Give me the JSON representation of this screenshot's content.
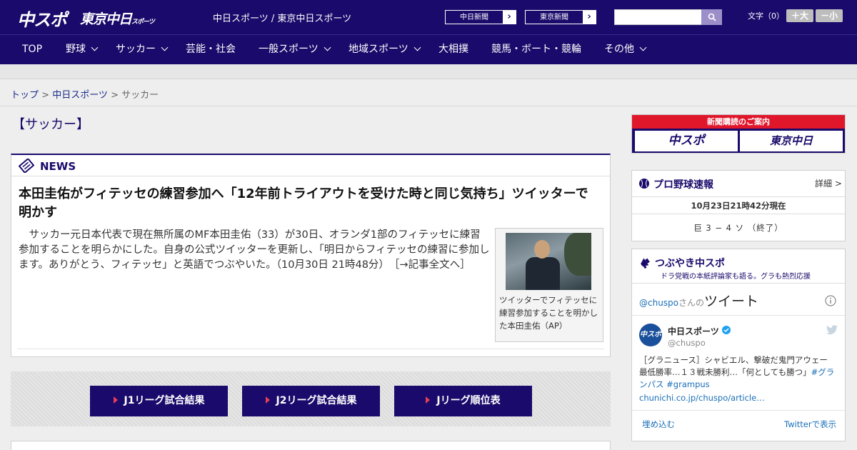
{
  "header": {
    "logo_primary": "中スポ",
    "logo_secondary": "東京中日",
    "logo_secondary_small": "スポーツ",
    "site_title": "中日スポーツ / 東京中日スポーツ",
    "ext_links": [
      {
        "label": "中日新聞"
      },
      {
        "label": "東京新聞"
      }
    ],
    "search": {
      "placeholder": ""
    },
    "text_size_label": "文字（0）",
    "text_size_plus": "＋大",
    "text_size_minus": "－小"
  },
  "nav": {
    "items": [
      {
        "label": "TOP"
      },
      {
        "label": "野球"
      },
      {
        "label": "サッカー"
      },
      {
        "label": "芸能・社会"
      },
      {
        "label": "一般スポーツ"
      },
      {
        "label": "地域スポーツ"
      },
      {
        "label": "大相撲"
      },
      {
        "label": "競馬・ボート・競輪"
      },
      {
        "label": "その他"
      }
    ]
  },
  "breadcrumb": {
    "home": "トップ",
    "sep": " > ",
    "parent": "中日スポーツ",
    "current": "サッカー"
  },
  "page": {
    "category": "【サッカー】"
  },
  "news": {
    "label": "NEWS",
    "title": "本田圭佑がフィテッセの練習参加へ「12年前トライアウトを受けた時と同じ気持ち」ツイッターで明かす",
    "body": "サッカー元日本代表で現在無所属のMF本田圭佑（33）が30日、オランダ1部のフィテッセに練習参加することを明らかにした。自身の公式ツイッターを更新し、「明日からフィテッセの練習に参加します。ありがとう、フィテッセ」と英語でつぶやいた。（10月30日 21時48分）",
    "more_link": "［→記事全文へ］",
    "photo_caption": "ツイッターでフィテッセに練習参加することを明かした本田圭佑（AP）"
  },
  "jleague": {
    "buttons": [
      {
        "label": "J1リーグ試合結果"
      },
      {
        "label": "J2リーグ試合結果"
      },
      {
        "label": "Jリーグ順位表"
      }
    ]
  },
  "sidebar": {
    "subscription": {
      "title": "新聞購読のご案内",
      "logo_left": "中スポ",
      "logo_right": "東京中日"
    },
    "baseball": {
      "title": "プロ野球速報",
      "detail": "詳細 >",
      "timestamp": "10月23日21時42分現在",
      "score": "巨 3 − 4 ソ （終了）"
    },
    "twitter": {
      "title": "つぶやき中スポ",
      "subtitle": "ドラ党戦の本紙評論家も語る。グラも熱烈応援",
      "handle": "@chuspo",
      "handle_suffix": "さんの",
      "heading": "ツイート",
      "user_name": "中日スポーツ",
      "user_id": "@chuspo",
      "avatar_text": "中スポ",
      "tweet_text": "［グラニュース］シャビエル、撃破だ鬼門アウェー　最低勝率…１３戦未勝利…「何としても勝つ」",
      "tweet_tags": "#グランパス #grampus",
      "tweet_link": "chunichi.co.jp/chuspo/article…",
      "embed": "埋め込む",
      "view_on_twitter": "Twitterで表示"
    }
  },
  "colors": {
    "brand_navy": "#1a0a6b",
    "accent_red": "#e0162b",
    "link_blue": "#1a6fb8"
  }
}
